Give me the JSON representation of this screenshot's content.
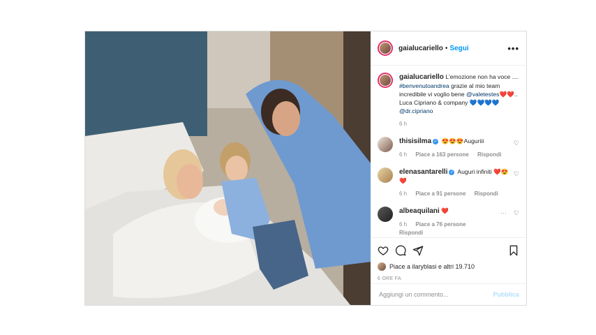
{
  "post": {
    "username": "gaialucariello",
    "follow_label": "Segui",
    "more_label": "•••",
    "caption_user": "gaialucariello",
    "caption_text_1": "L'emozione non ha voce .... ",
    "caption_hashtag": "#benvenutoandrea",
    "caption_text_2": " grazie al mio team incredibile vi voglio bene ",
    "caption_mention_1": "@valetestes",
    "caption_hearts": "❤️❤️",
    "caption_text_3": ".. Luca Cipriano & company ",
    "caption_blue_hearts": "💙💙💙💙",
    "caption_mention_2": "@dr.cipriano",
    "caption_time": "6 h",
    "comments": [
      {
        "user": "thisisilma",
        "text": "😍😍😍Auguriii",
        "time": "6 h",
        "likes": "Piace a 163 persone",
        "reply": "Rispondi"
      },
      {
        "user": "elenasantarelli",
        "text": "Auguri infiniti ❤️😍❤️",
        "time": "6 h",
        "likes": "Piace a 91 persone",
        "reply": "Rispondi"
      },
      {
        "user": "albeaquilani",
        "text": "❤️",
        "time": "6 h",
        "likes": "Piace a 76 persone",
        "reply": "Rispondi"
      }
    ],
    "likes_text": "Piace a ilaryblasi e altri 19.710",
    "time_ago": "6 ORE FA",
    "add_comment_placeholder": "Aggiungi un commento...",
    "publish_label": "Pubblica"
  },
  "colors": {
    "link": "#0095f6",
    "tag": "#00376b",
    "muted": "#8e8e8e",
    "border": "#dbdbdb"
  },
  "icons": [
    "more-icon",
    "heart-icon",
    "comment-icon",
    "share-icon",
    "bookmark-icon",
    "verified-icon"
  ]
}
